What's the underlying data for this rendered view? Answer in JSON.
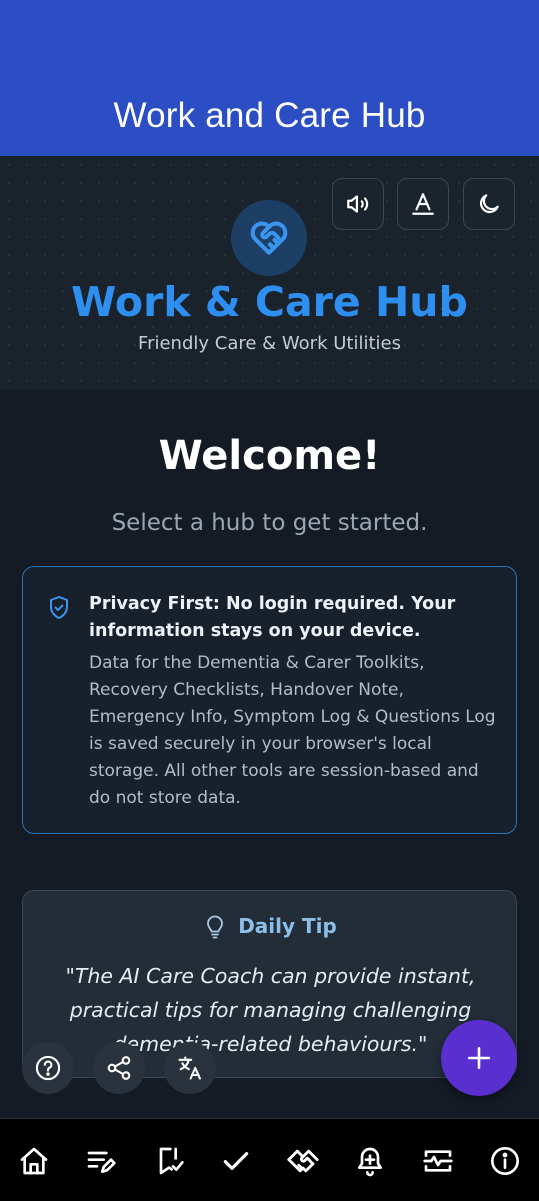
{
  "app_bar": {
    "title": "Work and Care Hub"
  },
  "hero": {
    "toolbar": {
      "read_aloud_icon": "volume-icon",
      "text_size_icon": "text-size-icon",
      "theme_icon": "moon-icon"
    },
    "logo_icon": "heart-handshake-icon",
    "title": "Work & Care Hub",
    "subtitle": "Friendly Care & Work Utilities"
  },
  "main": {
    "welcome": "Welcome!",
    "prompt": "Select a hub to get started.",
    "privacy": {
      "icon": "shield-check-icon",
      "title": "Privacy First: No login required. Your information stays on your device.",
      "body": "Data for the Dementia & Carer Toolkits, Recovery Checklists, Handover Note, Emergency Info, Symptom Log & Questions Log is saved securely in your browser's local storage. All other tools are session-based and do not store data."
    },
    "tip": {
      "icon": "lightbulb-icon",
      "title": "Daily Tip",
      "quote": "\"The AI Care Coach can provide instant, practical tips for managing challenging dementia-related behaviours.\""
    }
  },
  "floating_actions": {
    "help_icon": "help-icon",
    "share_icon": "share-icon",
    "translate_icon": "translate-icon",
    "add_icon": "plus-icon"
  },
  "bottom_nav": {
    "items": [
      {
        "icon": "home-icon"
      },
      {
        "icon": "notes-edit-icon"
      },
      {
        "icon": "bookmark-check-icon"
      },
      {
        "icon": "check-icon"
      },
      {
        "icon": "handshake-icon"
      },
      {
        "icon": "bell-plus-icon"
      },
      {
        "icon": "pulse-monitor-icon"
      },
      {
        "icon": "info-icon"
      }
    ]
  },
  "colors": {
    "app_bar": "#2b4ec4",
    "accent": "#2f8ff0",
    "fab": "#5a2fd0",
    "background": "#141b24"
  }
}
